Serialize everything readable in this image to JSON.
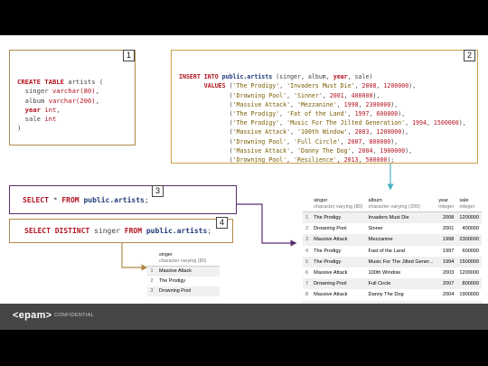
{
  "badges": [
    "1",
    "2",
    "3",
    "4"
  ],
  "box1": {
    "line1_kw": "CREATE TABLE",
    "line1_rest": " artists (",
    "singer_col": "  singer ",
    "singer_type": "varchar(80)",
    "album_col": "  album ",
    "album_type": "varchar(200)",
    "year_col": "  year ",
    "year_type": "int",
    "sale_col": "  sale ",
    "sale_type": "int",
    "close": ")"
  },
  "box2": {
    "insert_kw": "INSERT INTO ",
    "insert_table": "public.artists",
    "insert_cols_a": " (singer, album, ",
    "insert_cols_year": "year",
    "insert_cols_b": ", sale)",
    "values_kw": "VALUES",
    "rows": [
      {
        "singer": "'The Prodigy'",
        "album": "'Invaders Must Die'",
        "year": "2008",
        "sale": "1200000",
        "end": "),"
      },
      {
        "singer": "'Drowning Pool'",
        "album": "'Sinner'",
        "year": "2001",
        "sale": "400000",
        "end": "),"
      },
      {
        "singer": "'Massive Attack'",
        "album": "'Mezzanine'",
        "year": "1998",
        "sale": "2300000",
        "end": "),"
      },
      {
        "singer": "'The Prodigy'",
        "album": "'Fat of the Land'",
        "year": "1997",
        "sale": "600000",
        "end": "),"
      },
      {
        "singer": "'The Prodigy'",
        "album": "'Music For The Jilted Generation'",
        "year": "1994",
        "sale": "1500000",
        "end": "),"
      },
      {
        "singer": "'Massive Attack'",
        "album": "'100th Window'",
        "year": "2003",
        "sale": "1200000",
        "end": "),"
      },
      {
        "singer": "'Drowning Pool'",
        "album": "'Full Circle'",
        "year": "2007",
        "sale": "800000",
        "end": "),"
      },
      {
        "singer": "'Massive Attack'",
        "album": "'Danny The Dog'",
        "year": "2004",
        "sale": "1900000",
        "end": "),"
      },
      {
        "singer": "'Drowning Pool'",
        "album": "'Resilience'",
        "year": "2013",
        "sale": "500000",
        "end": ");"
      }
    ]
  },
  "box3": {
    "select_kw": "SELECT",
    "star": " * ",
    "from_kw": "FROM",
    "table": " public.artists",
    "semi": ";"
  },
  "box4": {
    "select_kw": "SELECT DISTINCT",
    "col": " singer ",
    "from_kw": "FROM",
    "table": " public.artists",
    "semi": ";"
  },
  "result_full": {
    "columns": [
      {
        "name": "singer",
        "type": "character varying (80)"
      },
      {
        "name": "album",
        "type": "character varying (200)"
      },
      {
        "name": "year",
        "type": "integer"
      },
      {
        "name": "sale",
        "type": "integer"
      }
    ],
    "rows": [
      {
        "n": "1",
        "singer": "The Prodigy",
        "album": "Invaders Must Die",
        "year": "2008",
        "sale": "1200000"
      },
      {
        "n": "2",
        "singer": "Drowning Pool",
        "album": "Sinner",
        "year": "2001",
        "sale": "400000"
      },
      {
        "n": "3",
        "singer": "Massive Attack",
        "album": "Mezzanine",
        "year": "1998",
        "sale": "2300000"
      },
      {
        "n": "4",
        "singer": "The Prodigy",
        "album": "Fast of the Land",
        "year": "1997",
        "sale": "600000"
      },
      {
        "n": "5",
        "singer": "The Prodigy",
        "album": "Music For The Jilted Gener...",
        "year": "1994",
        "sale": "1500000"
      },
      {
        "n": "6",
        "singer": "Massive Attack",
        "album": "100th Window",
        "year": "2003",
        "sale": "1200000"
      },
      {
        "n": "7",
        "singer": "Drowning Pool",
        "album": "Full Circle",
        "year": "2007",
        "sale": "800000"
      },
      {
        "n": "8",
        "singer": "Massive Attack",
        "album": "Danny The Dog",
        "year": "2004",
        "sale": "1900000"
      },
      {
        "n": "9",
        "singer": "Drowning Pool",
        "album": "Resilience",
        "year": "2013",
        "sale": "500000"
      }
    ]
  },
  "result_distinct": {
    "column": {
      "name": "singer",
      "type": "character varying (80)"
    },
    "rows": [
      {
        "n": "1",
        "singer": "Massive Attack"
      },
      {
        "n": "2",
        "singer": "The Prodigy"
      },
      {
        "n": "3",
        "singer": "Drowning Pool"
      }
    ]
  },
  "footer": {
    "logo": "<epam>",
    "label": "CONFIDENTIAL"
  },
  "colors": {
    "box1_border": "#b08a4a",
    "box2_border": "#c8a24a",
    "box3_border": "#5a2d6e",
    "box4_border": "#b08a4a",
    "arrow_teal": "#4fb3c6",
    "arrow_purple": "#5a2d6e",
    "arrow_tan": "#b08a4a",
    "keyword": "#b3121f"
  }
}
